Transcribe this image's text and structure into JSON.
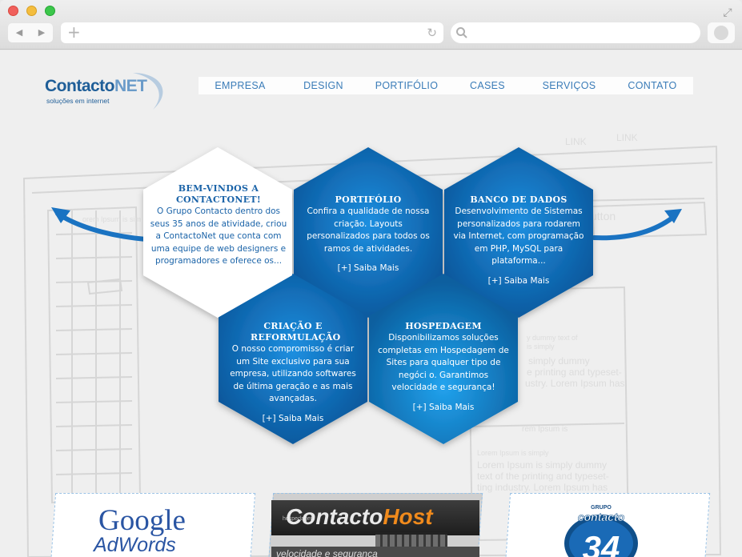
{
  "browser": {
    "back_icon": "◀",
    "forward_icon": "▶",
    "new_tab_icon": "+",
    "reload_icon": "↻",
    "fullscreen_icon": "⤢"
  },
  "site": {
    "logo": {
      "word_main": "Contacto",
      "word_accent": "NET",
      "tagline": "soluções em internet"
    },
    "menu": [
      "EMPRESA",
      "DESIGN",
      "PORTIFÓLIO",
      "CASES",
      "SERVIÇOS",
      "CONTATO"
    ],
    "sketch_texts": {
      "link1": "LINK",
      "link2": "LINK",
      "button": "utton",
      "lorem_a": "orem Ipsum is sim",
      "lorem_b1": "y dummy text of",
      "lorem_b2": "is simply",
      "lorem_c1": "simply dummy",
      "lorem_c2": "e printing and typeset-",
      "lorem_c3": "ustry. Lorem Ipsum has",
      "lorem_d": "rem Ipsum is",
      "lorem_e1": "Lorem Ipsum is simply",
      "lorem_e2": "Lorem Ipsum is simply dummy",
      "lorem_e3": "text of the printing and typeset-",
      "lorem_e4": "ting industry. Lorem Ipsum has"
    },
    "hexes": [
      {
        "title": "BEM-VINDOS A CONTACTONET!",
        "body": "O Grupo Contacto dentro dos seus 35 anos de atividade, criou a ContactoNet que conta com uma equipe de web designers e programadores e oferece os...",
        "link": ""
      },
      {
        "title": "PORTIFÓLIO",
        "body": "Confira a qualidade de nossa criação. Layouts personalizados para todos os ramos de atividades.",
        "link": "[+] Saiba Mais"
      },
      {
        "title": "BANCO DE DADOS",
        "body": "Desenvolvimento de Sistemas personalizados para rodarem via Internet, com programação em PHP, MySQL para plataforma...",
        "link": "[+] Saiba Mais"
      },
      {
        "title": "CRIAÇÃO E REFORMULAÇÃO",
        "body": "O nosso compromisso é criar um Site exclusivo para sua empresa, utilizando softwares de última geração e as mais avançadas.",
        "link": "[+] Saiba Mais"
      },
      {
        "title": "HOSPEDAGEM",
        "body": "Disponibilizamos soluções completas em Hospedagem de Sites para qualquer tipo de negóci o. Garantimos velocidade e segurança!",
        "link": "[+] Saiba Mais"
      }
    ],
    "banners": {
      "adwords_line1": "Google",
      "adwords_line2": "AdWords",
      "host_small": "hospedagem",
      "host_word_main": "Contacto",
      "host_word_accent": "Host",
      "host_tag": "velocidade e segurança",
      "grupo_small": "GRUPO",
      "grupo_word": "contacto",
      "grupo_number": "34"
    },
    "colors": {
      "hex_blue": "#0b6cb4",
      "hex_blue_dark": "#0a4f8e",
      "brand_blue": "#1f5e98",
      "menu_blue": "#3a7cb8"
    }
  }
}
